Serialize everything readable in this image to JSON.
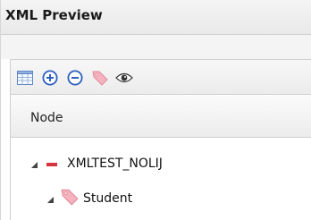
{
  "panel": {
    "title": "XML Preview"
  },
  "toolbar": {
    "buttons": [
      {
        "icon": "table-icon",
        "tooltip": ""
      },
      {
        "icon": "add-circle-icon",
        "tooltip": ""
      },
      {
        "icon": "remove-circle-icon",
        "tooltip": ""
      },
      {
        "icon": "tag-icon",
        "tooltip": ""
      },
      {
        "icon": "eye-icon",
        "tooltip": ""
      }
    ]
  },
  "tree": {
    "column_header": "Node",
    "rows": [
      {
        "label": "XMLTEST_NOLIJ",
        "icon": "minus-icon",
        "expanded": true
      },
      {
        "label": "Student",
        "icon": "tag-icon",
        "expanded": true
      }
    ]
  },
  "colors": {
    "accent_blue": "#2e5fbf",
    "minus_red": "#d9333f",
    "tag_pink": "#ef9aa8"
  }
}
